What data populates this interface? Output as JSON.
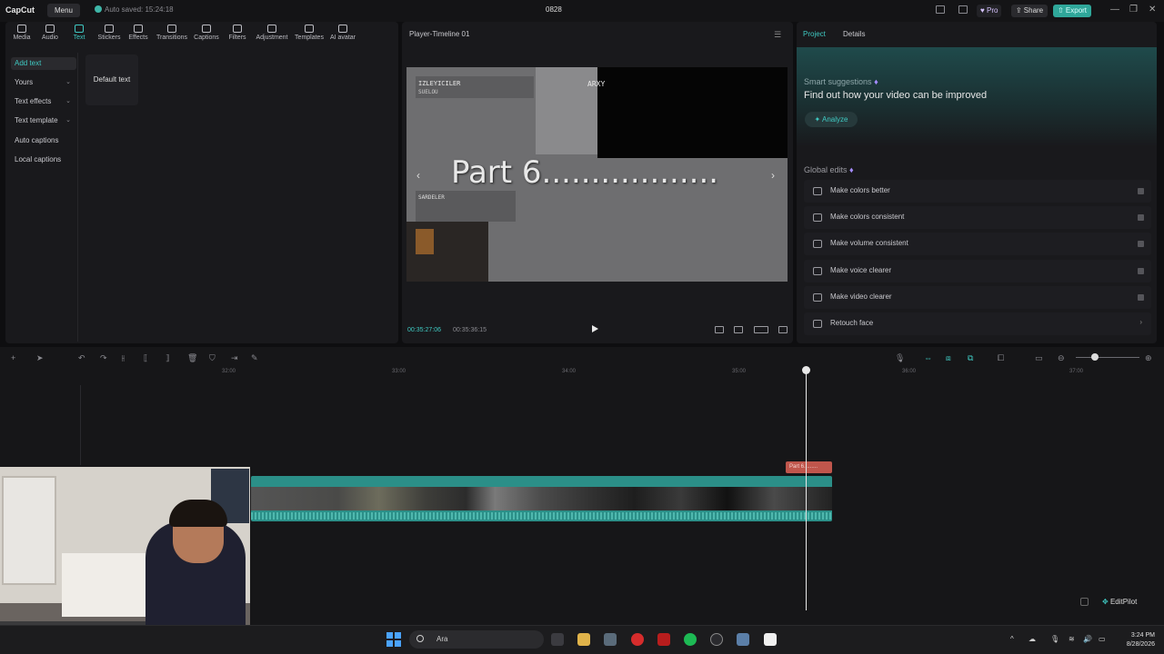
{
  "titlebar": {
    "logo": "CapCut",
    "menu_label": "Menu",
    "autosave": "Auto saved: 15:24:18",
    "project_name": "0828",
    "pro_label": "Pro",
    "share_label": "Share",
    "export_label": "Export"
  },
  "tool_tabs": [
    {
      "label": "Media"
    },
    {
      "label": "Audio"
    },
    {
      "label": "Text"
    },
    {
      "label": "Stickers"
    },
    {
      "label": "Effects"
    },
    {
      "label": "Transitions"
    },
    {
      "label": "Captions"
    },
    {
      "label": "Filters"
    },
    {
      "label": "Adjustment"
    },
    {
      "label": "Templates"
    },
    {
      "label": "AI avatar"
    }
  ],
  "side_nav": {
    "items": [
      {
        "label": "Add text"
      },
      {
        "label": "Yours"
      },
      {
        "label": "Text effects"
      },
      {
        "label": "Text template"
      },
      {
        "label": "Auto captions"
      },
      {
        "label": "Local captions"
      }
    ],
    "default_text": "Default text"
  },
  "player": {
    "title": "Player-Timeline 01",
    "overlay_text": "Part 6..................",
    "game_label": "ARXY",
    "hud_name": "IZLEYICILER",
    "hud_sub": "SUELOU",
    "hud_name2": "SARDELER",
    "time_current": "00:35:27:06",
    "time_total": "00:35:36:15"
  },
  "right_panel": {
    "tab_project": "Project",
    "tab_details": "Details",
    "smart_label": "Smart suggestions",
    "smart_desc": "Find out how your video can be improved",
    "analyze_label": "Analyze",
    "global_label": "Global edits",
    "global_edits": [
      {
        "label": "Make colors better",
        "icon": "wand-icon"
      },
      {
        "label": "Make colors consistent",
        "icon": "palette-icon"
      },
      {
        "label": "Make volume consistent",
        "icon": "equalizer-icon"
      },
      {
        "label": "Make voice clearer",
        "icon": "voice-icon"
      },
      {
        "label": "Make video clearer",
        "icon": "hd-icon"
      },
      {
        "label": "Retouch face",
        "icon": "face-icon"
      }
    ]
  },
  "timeline": {
    "ticks": [
      "32:00",
      "33:00",
      "34:00",
      "35:00",
      "36:00",
      "37:00"
    ],
    "text_clip_label": "Part 6.........",
    "editpilot_label": "EditPilot"
  },
  "taskbar": {
    "search_placeholder": "Ara",
    "time": "3:24 PM",
    "date": "8/28/2026"
  },
  "colors": {
    "accent": "#3fc9c2",
    "export": "#2fa79a",
    "text_clip": "#c0564c",
    "video_clip": "#2b8f88"
  }
}
